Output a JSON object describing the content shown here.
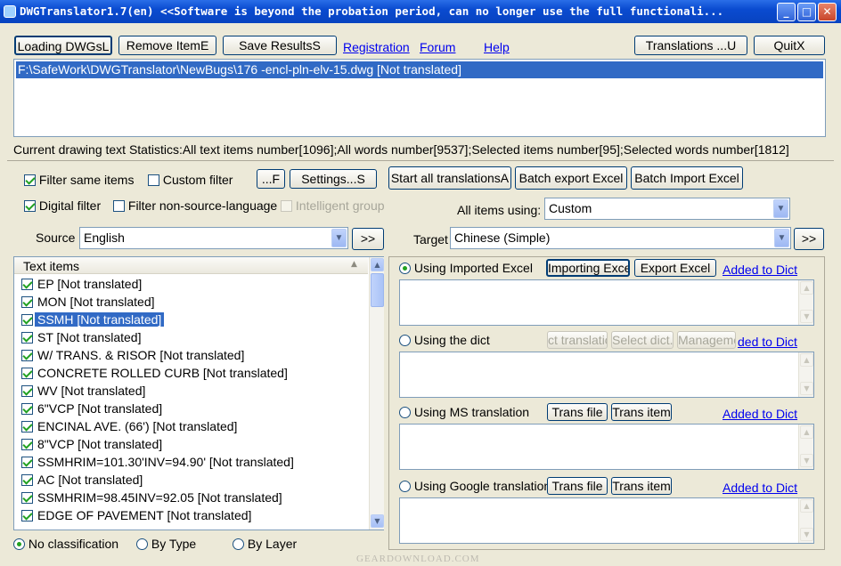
{
  "window": {
    "title": "DWGTranslator1.7(en) <<Software is beyond the probation period, can no longer use the full functionali...",
    "min": "_",
    "max": "□",
    "close": "✕"
  },
  "toolbar": {
    "loading": "Loading DWGsL",
    "remove": "Remove ItemE",
    "save": "Save ResultsS",
    "registration": "Registration",
    "forum": "Forum",
    "help": "Help",
    "translations": "Translations ...U",
    "quit": "QuitX"
  },
  "files": [
    "F:\\SafeWork\\DWGTranslator\\NewBugs\\176 -encl-pln-elv-15.dwg  [Not translated]"
  ],
  "stats": "Current drawing text Statistics:All text items number[1096];All words number[9537];Selected items number[95];Selected words number[1812]",
  "filters": {
    "filter_same": "Filter same items",
    "custom_filter": "Custom filter",
    "f_btn": "...F",
    "settings": "Settings...S",
    "digital": "Digital filter",
    "non_source": "Filter non-source-language",
    "intelligent": "Intelligent group"
  },
  "actions": {
    "start_all": "Start all translationsA",
    "batch_export": "Batch export Excel",
    "batch_import": "Batch Import Excel"
  },
  "all_items": {
    "label": "All items using:",
    "value": "Custom"
  },
  "source": {
    "label": "Source",
    "value": "English",
    "arrow": ">>"
  },
  "target": {
    "label": "Target",
    "value": "Chinese (Simple)",
    "arrow": ">>"
  },
  "text_items_header": "Text items",
  "text_items": [
    {
      "label": "EP  [Not translated]"
    },
    {
      "label": "MON  [Not translated]"
    },
    {
      "label": "SSMH  [Not translated]"
    },
    {
      "label": "ST  [Not translated]"
    },
    {
      "label": "W/ TRANS. & RISOR  [Not translated]"
    },
    {
      "label": "CONCRETE ROLLED CURB  [Not translated]"
    },
    {
      "label": "WV  [Not translated]"
    },
    {
      "label": "6\"VCP  [Not translated]"
    },
    {
      "label": "ENCINAL AVE. (66')  [Not translated]"
    },
    {
      "label": "8\"VCP  [Not translated]"
    },
    {
      "label": "SSMHRIM=101.30'INV=94.90'  [Not translated]"
    },
    {
      "label": "AC  [Not translated]"
    },
    {
      "label": "SSMHRIM=98.45INV=92.05  [Not translated]"
    },
    {
      "label": "EDGE OF PAVEMENT  [Not translated]"
    }
  ],
  "classification": {
    "none": "No classification",
    "by_type": "By Type",
    "by_layer": "By Layer"
  },
  "sections": {
    "imported_excel": {
      "label": "Using Imported Excel",
      "import": "Importing Excel",
      "export": "Export Excel",
      "dict": "Added to Dict"
    },
    "dict": {
      "label": "Using the dict",
      "b1": "ct translatio",
      "b2": "Select dict...",
      "b3": "Manageme",
      "dict": "ded to Dict"
    },
    "ms": {
      "label": "Using MS translation",
      "trans_file": "Trans file",
      "trans_item": "Trans item",
      "dict": "Added to Dict"
    },
    "google": {
      "label": "Using Google translation",
      "trans_file": "Trans file",
      "trans_item": "Trans item",
      "dict": "Added to Dict"
    }
  },
  "watermark": "GEARDOWNLOAD.COM"
}
